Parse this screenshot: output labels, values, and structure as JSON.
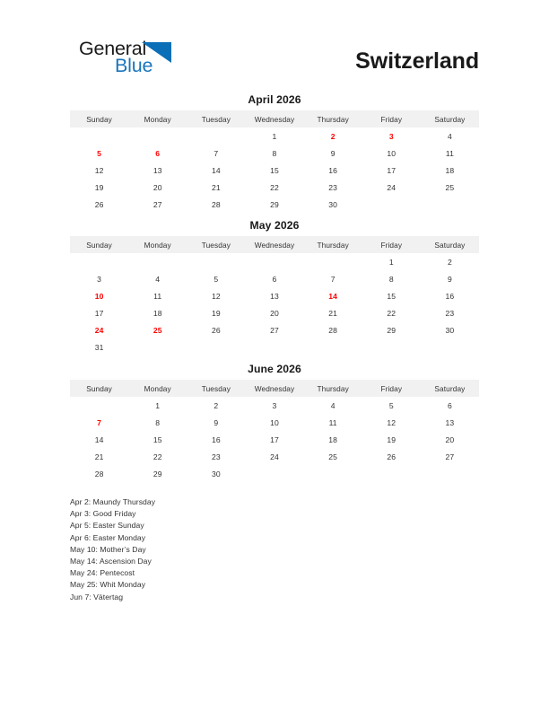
{
  "brand": {
    "name_part1": "General",
    "name_part2": "Blue",
    "logo_icon": "blue-triangle-icon",
    "accent_color": "#1b75bc"
  },
  "header": {
    "title": "Switzerland"
  },
  "colors": {
    "holiday_red": "#ff0000",
    "header_row_bg": "#f1f1f1",
    "text": "#333333"
  },
  "weekday_headers": [
    "Sunday",
    "Monday",
    "Tuesday",
    "Wednesday",
    "Thursday",
    "Friday",
    "Saturday"
  ],
  "months": [
    {
      "title": "April 2026",
      "weeks": [
        [
          {
            "day": "",
            "holiday": false
          },
          {
            "day": "",
            "holiday": false
          },
          {
            "day": "",
            "holiday": false
          },
          {
            "day": "1",
            "holiday": false
          },
          {
            "day": "2",
            "holiday": true
          },
          {
            "day": "3",
            "holiday": true
          },
          {
            "day": "4",
            "holiday": false
          }
        ],
        [
          {
            "day": "5",
            "holiday": true
          },
          {
            "day": "6",
            "holiday": true
          },
          {
            "day": "7",
            "holiday": false
          },
          {
            "day": "8",
            "holiday": false
          },
          {
            "day": "9",
            "holiday": false
          },
          {
            "day": "10",
            "holiday": false
          },
          {
            "day": "11",
            "holiday": false
          }
        ],
        [
          {
            "day": "12",
            "holiday": false
          },
          {
            "day": "13",
            "holiday": false
          },
          {
            "day": "14",
            "holiday": false
          },
          {
            "day": "15",
            "holiday": false
          },
          {
            "day": "16",
            "holiday": false
          },
          {
            "day": "17",
            "holiday": false
          },
          {
            "day": "18",
            "holiday": false
          }
        ],
        [
          {
            "day": "19",
            "holiday": false
          },
          {
            "day": "20",
            "holiday": false
          },
          {
            "day": "21",
            "holiday": false
          },
          {
            "day": "22",
            "holiday": false
          },
          {
            "day": "23",
            "holiday": false
          },
          {
            "day": "24",
            "holiday": false
          },
          {
            "day": "25",
            "holiday": false
          }
        ],
        [
          {
            "day": "26",
            "holiday": false
          },
          {
            "day": "27",
            "holiday": false
          },
          {
            "day": "28",
            "holiday": false
          },
          {
            "day": "29",
            "holiday": false
          },
          {
            "day": "30",
            "holiday": false
          },
          {
            "day": "",
            "holiday": false
          },
          {
            "day": "",
            "holiday": false
          }
        ]
      ]
    },
    {
      "title": "May 2026",
      "weeks": [
        [
          {
            "day": "",
            "holiday": false
          },
          {
            "day": "",
            "holiday": false
          },
          {
            "day": "",
            "holiday": false
          },
          {
            "day": "",
            "holiday": false
          },
          {
            "day": "",
            "holiday": false
          },
          {
            "day": "1",
            "holiday": false
          },
          {
            "day": "2",
            "holiday": false
          }
        ],
        [
          {
            "day": "3",
            "holiday": false
          },
          {
            "day": "4",
            "holiday": false
          },
          {
            "day": "5",
            "holiday": false
          },
          {
            "day": "6",
            "holiday": false
          },
          {
            "day": "7",
            "holiday": false
          },
          {
            "day": "8",
            "holiday": false
          },
          {
            "day": "9",
            "holiday": false
          }
        ],
        [
          {
            "day": "10",
            "holiday": true
          },
          {
            "day": "11",
            "holiday": false
          },
          {
            "day": "12",
            "holiday": false
          },
          {
            "day": "13",
            "holiday": false
          },
          {
            "day": "14",
            "holiday": true
          },
          {
            "day": "15",
            "holiday": false
          },
          {
            "day": "16",
            "holiday": false
          }
        ],
        [
          {
            "day": "17",
            "holiday": false
          },
          {
            "day": "18",
            "holiday": false
          },
          {
            "day": "19",
            "holiday": false
          },
          {
            "day": "20",
            "holiday": false
          },
          {
            "day": "21",
            "holiday": false
          },
          {
            "day": "22",
            "holiday": false
          },
          {
            "day": "23",
            "holiday": false
          }
        ],
        [
          {
            "day": "24",
            "holiday": true
          },
          {
            "day": "25",
            "holiday": true
          },
          {
            "day": "26",
            "holiday": false
          },
          {
            "day": "27",
            "holiday": false
          },
          {
            "day": "28",
            "holiday": false
          },
          {
            "day": "29",
            "holiday": false
          },
          {
            "day": "30",
            "holiday": false
          }
        ],
        [
          {
            "day": "31",
            "holiday": false
          },
          {
            "day": "",
            "holiday": false
          },
          {
            "day": "",
            "holiday": false
          },
          {
            "day": "",
            "holiday": false
          },
          {
            "day": "",
            "holiday": false
          },
          {
            "day": "",
            "holiday": false
          },
          {
            "day": "",
            "holiday": false
          }
        ]
      ]
    },
    {
      "title": "June 2026",
      "weeks": [
        [
          {
            "day": "",
            "holiday": false
          },
          {
            "day": "1",
            "holiday": false
          },
          {
            "day": "2",
            "holiday": false
          },
          {
            "day": "3",
            "holiday": false
          },
          {
            "day": "4",
            "holiday": false
          },
          {
            "day": "5",
            "holiday": false
          },
          {
            "day": "6",
            "holiday": false
          }
        ],
        [
          {
            "day": "7",
            "holiday": true
          },
          {
            "day": "8",
            "holiday": false
          },
          {
            "day": "9",
            "holiday": false
          },
          {
            "day": "10",
            "holiday": false
          },
          {
            "day": "11",
            "holiday": false
          },
          {
            "day": "12",
            "holiday": false
          },
          {
            "day": "13",
            "holiday": false
          }
        ],
        [
          {
            "day": "14",
            "holiday": false
          },
          {
            "day": "15",
            "holiday": false
          },
          {
            "day": "16",
            "holiday": false
          },
          {
            "day": "17",
            "holiday": false
          },
          {
            "day": "18",
            "holiday": false
          },
          {
            "day": "19",
            "holiday": false
          },
          {
            "day": "20",
            "holiday": false
          }
        ],
        [
          {
            "day": "21",
            "holiday": false
          },
          {
            "day": "22",
            "holiday": false
          },
          {
            "day": "23",
            "holiday": false
          },
          {
            "day": "24",
            "holiday": false
          },
          {
            "day": "25",
            "holiday": false
          },
          {
            "day": "26",
            "holiday": false
          },
          {
            "day": "27",
            "holiday": false
          }
        ],
        [
          {
            "day": "28",
            "holiday": false
          },
          {
            "day": "29",
            "holiday": false
          },
          {
            "day": "30",
            "holiday": false
          },
          {
            "day": "",
            "holiday": false
          },
          {
            "day": "",
            "holiday": false
          },
          {
            "day": "",
            "holiday": false
          },
          {
            "day": "",
            "holiday": false
          }
        ]
      ]
    }
  ],
  "holiday_legend": [
    "Apr 2: Maundy Thursday",
    "Apr 3: Good Friday",
    "Apr 5: Easter Sunday",
    "Apr 6: Easter Monday",
    "May 10: Mother’s Day",
    "May 14: Ascension Day",
    "May 24: Pentecost",
    "May 25: Whit Monday",
    "Jun 7: Vätertag"
  ]
}
